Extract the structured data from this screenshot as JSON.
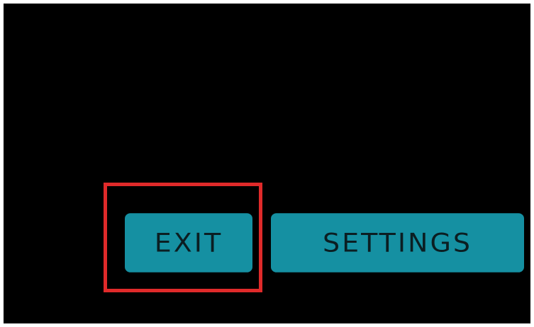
{
  "buttons": {
    "exit_label": "EXIT",
    "settings_label": "SETTINGS"
  },
  "colors": {
    "screen_background": "#000000",
    "button_background": "#1590a2",
    "button_text": "#0b1e22",
    "highlight_border": "#e02a2a"
  }
}
